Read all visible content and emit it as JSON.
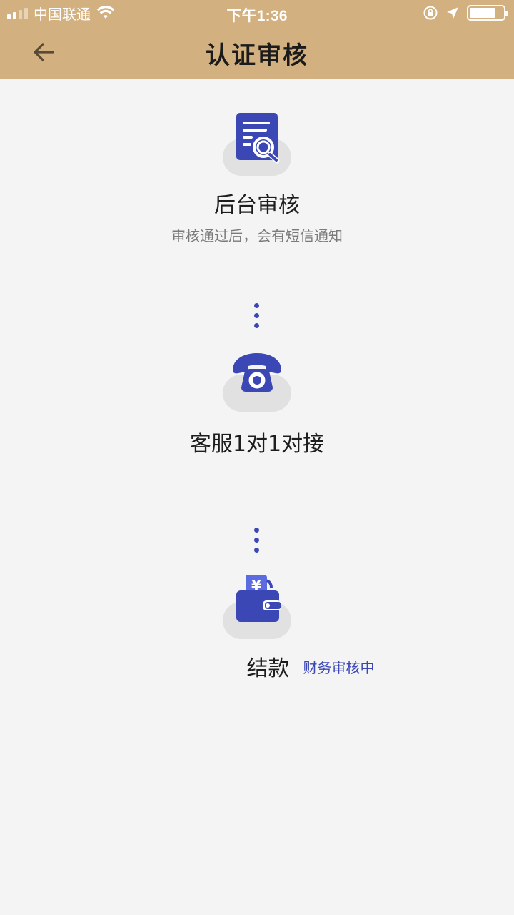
{
  "status_bar": {
    "carrier": "中国联通",
    "time": "下午1:36",
    "battery_level": 0.75
  },
  "nav": {
    "title": "认证审核",
    "back_icon": "arrow-left-icon"
  },
  "colors": {
    "header_bg": "#d3b07f",
    "accent": "#3b47b4",
    "page_bg": "#f4f4f4"
  },
  "steps": [
    {
      "icon": "document-search-icon",
      "title": "后台审核",
      "subtitle": "审核通过后，会有短信通知"
    },
    {
      "icon": "telephone-icon",
      "title": "客服1对1对接"
    },
    {
      "icon": "wallet-icon",
      "title": "结款",
      "status": "财务审核中"
    }
  ]
}
